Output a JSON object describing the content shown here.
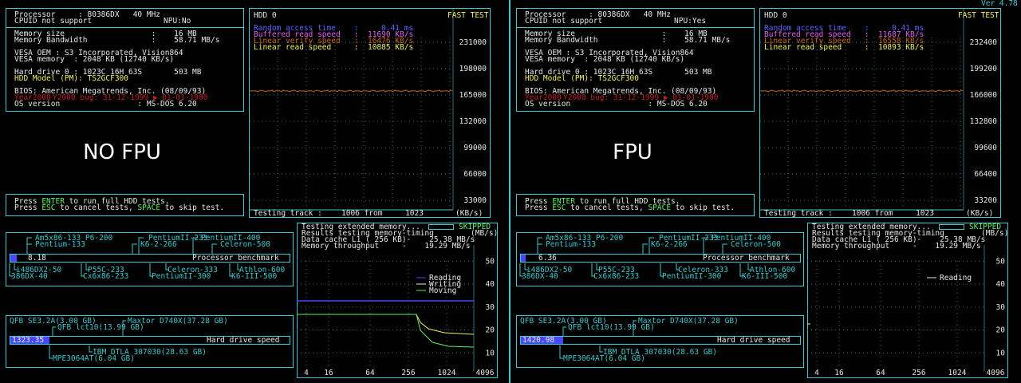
{
  "version": "Ver 4.78",
  "colors": {
    "cyan": "#3ec8d0",
    "yellow": "#f0f060",
    "orange": "#c86418",
    "blue": "#4848ff",
    "green": "#60f060"
  },
  "panels": [
    {
      "label": "NO FPU",
      "sys": {
        "processor": "Processor     : 80386DX   40 MHz",
        "cpuid": "CPUID not support",
        "npu": "NPU:No",
        "mem_size": "Memory size                   :    16 MB",
        "mem_bw": "Memory Bandwidth              :    58.71 MB/s",
        "vesa_oem": "VESA OEM : S3 Incorporated, Vision864",
        "vesa_mem": "VESA memory  : 2048 KB (12740 KB/s)",
        "hdd0": "Hard drive 0 : 1023C 16H 63S       503 MB",
        "hdd_model": "HDD Model (PM): TS2GCF300",
        "bios": "BIOS: American Megatrends, Inc. (08/09/93)",
        "y2k": "Y2000 bug: 31-12-1999 ▶ 01-01-1900",
        "y2k_label": "Year2000",
        "os": "OS version                 : MS-DOS 6.20"
      },
      "prompt1a": "Press ",
      "prompt1b": "ENTER",
      "prompt1c": " to run full HDD tests.",
      "prompt2a": "Press ",
      "prompt2b": "ESC",
      "prompt2c": " to cancel tests, ",
      "prompt2d": "SPACE",
      "prompt2e": " to skip test.",
      "hdd": {
        "title": "HDD 0",
        "mode": "FAST TEST",
        "random": "Random access time    :     0.41 ms",
        "buffered": "Buffered read speed   :  11690 KB/s",
        "verify": "Linear verify speed   :  16476 KB/s",
        "linear": "Linear read speed     :  10885 KB/s",
        "ticks": [
          "231000",
          "198000",
          "165000",
          "132000",
          "99000",
          "66000",
          "33000"
        ],
        "track_label": "Testing track :",
        "track_val": "1006 from     1023",
        "units": "(KB/s)",
        "level_fraction": 0.714
      },
      "cpu": {
        "score": "8.18",
        "bench_label": "Processor benchmark",
        "score_fraction": 0.022,
        "top1": "Am5x86-133 P6-200",
        "top2": "Pentium-133",
        "top3": "PentiumII-233",
        "top4": "K6-2-266",
        "top5": "PentiumII-400",
        "top6": "Celeron-500",
        "bot1": "i486DX2-50",
        "bot2": "386DX-40",
        "bot3": "P55C-233",
        "bot4": "Cx6x86-233",
        "bot5": "Celeron-333",
        "bot6": "PentiumII-300",
        "bot7": "Athlon-600",
        "bot8": "K6-III-500"
      },
      "disk": {
        "score": "1323.35",
        "label": "Hard drive speed",
        "score_fraction": 0.14,
        "top1": "QFB SE3.2A(3.00 GB)",
        "top2": "Maxtor D740X(37.28 GB)",
        "top3": "QFB lct10(13.99 GB)",
        "bot1": "IBM DTLA 307030(28.63 GB)",
        "bot2": "MPE3064AT(6.04 GB)"
      },
      "mem": {
        "line1": "Testing extended memory...",
        "skipped": "SKIPPED",
        "line2": "Results testing memory-timing",
        "units": "(MB/s)",
        "l1": "Data cache L1 ( 256 KB)-    25.38 MB/s",
        "thru": "Memory throughput     -    19.29 MB/s",
        "legend": [
          "Reading",
          "Writing",
          "Moving"
        ],
        "show_all_series": true,
        "yticks": [
          "50",
          "40",
          "30",
          "20",
          "10"
        ],
        "xticks": [
          "4",
          "16",
          "64",
          "256",
          "1024",
          "4096"
        ]
      }
    },
    {
      "label": "FPU",
      "sys": {
        "processor": "Processor     : 80386DX   40 MHz",
        "cpuid": "CPUID not support",
        "npu": "NPU:Yes",
        "mem_size": "Memory size                   :    16 MB",
        "mem_bw": "Memory Bandwidth              :    58.71 MB/s",
        "vesa_oem": "VESA OEM : S3 Incorporated, Vision864",
        "vesa_mem": "VESA memory  : 2048 KB (12740 KB/s)",
        "hdd0": "Hard drive 0 : 1023C 16H 63S       503 MB",
        "hdd_model": "HDD Model (PM): TS2GCF300",
        "bios": "BIOS: American Megatrends, Inc. (08/09/93)",
        "y2k": "Y2000 bug: 31-12-1999 ▶ 01-01-1900",
        "y2k_label": "Year2000",
        "os": "OS version                 : MS-DOS 6.20"
      },
      "prompt1a": "Press ",
      "prompt1b": "ENTER",
      "prompt1c": " to run full HDD tests.",
      "prompt2a": "Press ",
      "prompt2b": "ESC",
      "prompt2c": " to cancel tests, ",
      "prompt2d": "SPACE",
      "prompt2e": " to skip test.",
      "hdd": {
        "title": "HDD 0",
        "mode": "FAST TEST",
        "random": "Random access time    :     0.41 ms",
        "buffered": "Buffered read speed   :  11687 KB/s",
        "verify": "Linear verify speed   :  16558 KB/s",
        "linear": "Linear read speed     :  10893 KB/s",
        "ticks": [
          "232400",
          "199200",
          "166000",
          "132800",
          "99600",
          "66400",
          "33200"
        ],
        "track_label": "Testing track :",
        "track_val": "1006 from     1023",
        "units": "(KB/s)",
        "level_fraction": 0.714
      },
      "cpu": {
        "score": "6.36",
        "bench_label": "Processor benchmark",
        "score_fraction": 0.017,
        "top1": "Am5x86-133 P6-200",
        "top2": "Pentium-133",
        "top3": "PentiumII-233",
        "top4": "K6-2-266",
        "top5": "PentiumII-400",
        "top6": "Celeron-500",
        "bot1": "i486DX2-50",
        "bot2": "386DX-40",
        "bot3": "P55C-233",
        "bot4": "Cx6x86-233",
        "bot5": "Celeron-333",
        "bot6": "PentiumII-300",
        "bot7": "Athlon-600",
        "bot8": "K6-III-500"
      },
      "disk": {
        "score": "1420.98",
        "label": "Hard drive speed",
        "score_fraction": 0.15,
        "top1": "QFB SE3.2A(3.00 GB)",
        "top2": "Maxtor D740X(37.28 GB)",
        "top3": "QFB lct10(13.99 GB)",
        "bot1": "IBM DTLA 307030(28.63 GB)",
        "bot2": "MPE3064AT(6.04 GB)"
      },
      "mem": {
        "line1": "Testing extended memory...",
        "skipped": "SKIPPED",
        "line2": "Results testing memory-timing",
        "units": "(MB/s)",
        "l1": "Data cache L1 ( 256 KB)-    25.38 MB/s",
        "thru": "Memory throughput     -    19.29 MB/s",
        "legend": [
          "Reading"
        ],
        "show_all_series": false,
        "yticks": [
          "50",
          "40",
          "30",
          "20",
          "10"
        ],
        "xticks": [
          "4",
          "16",
          "64",
          "256",
          "1024",
          "4096"
        ]
      }
    }
  ]
}
